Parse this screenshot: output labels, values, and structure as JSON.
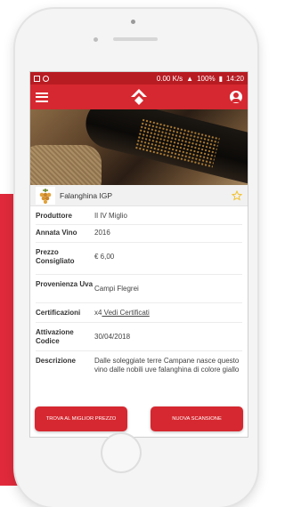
{
  "status_bar": {
    "speed": "0.00 K/s",
    "battery": "100%",
    "time": "14:20"
  },
  "colors": {
    "brand_red": "#d62830",
    "status_red": "#b71c22",
    "background_red": "#e02a3b",
    "star_yellow": "#f2c12e"
  },
  "app_bar": {
    "menu_icon": "hamburger-icon",
    "logo_icon": "diamond-logo-icon",
    "account_icon": "account-icon"
  },
  "wine": {
    "name": "Falanghina IGP",
    "favorite_icon": "star-outline-icon"
  },
  "details": [
    {
      "label": "Produttore",
      "value": "Il IV Miglio"
    },
    {
      "label": "Annata Vino",
      "value": "2016"
    },
    {
      "label": "Prezzo Consigliato",
      "value": "€ 6,00"
    },
    {
      "label": "Provenienza Uva",
      "value": "Campi Flegrei"
    },
    {
      "label": "Certificazioni",
      "value_prefix": "x4",
      "link": " Vedi Certificati"
    },
    {
      "label": "Attivazione Codice",
      "value": "30/04/2018"
    },
    {
      "label": "Descrizione",
      "value": "Dalle soleggiate terre Campane nasce questo vino dalle nobili uve falanghina di colore giallo paglierino"
    }
  ],
  "buttons": {
    "best_price": "TROVA AL MIGLIOR PREZZO",
    "new_scan": "NUOVA SCANSIONE"
  }
}
